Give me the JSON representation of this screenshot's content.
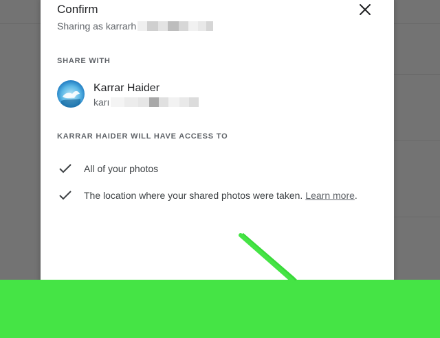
{
  "dialog": {
    "title": "Confirm",
    "sharing_prefix": "Sharing as karrarh",
    "share_with_label": "SHARE WITH",
    "contact": {
      "name": "Karrar Haider",
      "email_prefix": "karı"
    },
    "access_label": "KARRAR HAIDER WILL HAVE ACCESS TO",
    "access_items": [
      {
        "text": "All of your photos"
      },
      {
        "text": "The location where your shared photos were taken.",
        "link": "Learn more",
        "suffix": "."
      }
    ]
  },
  "icons": {
    "close": "close-icon",
    "check": "check-icon",
    "avatar": "avatar",
    "arrow": "green-arrow-annotation"
  },
  "colors": {
    "highlight_green": "#45e445",
    "overlay_gray": "#737373"
  }
}
